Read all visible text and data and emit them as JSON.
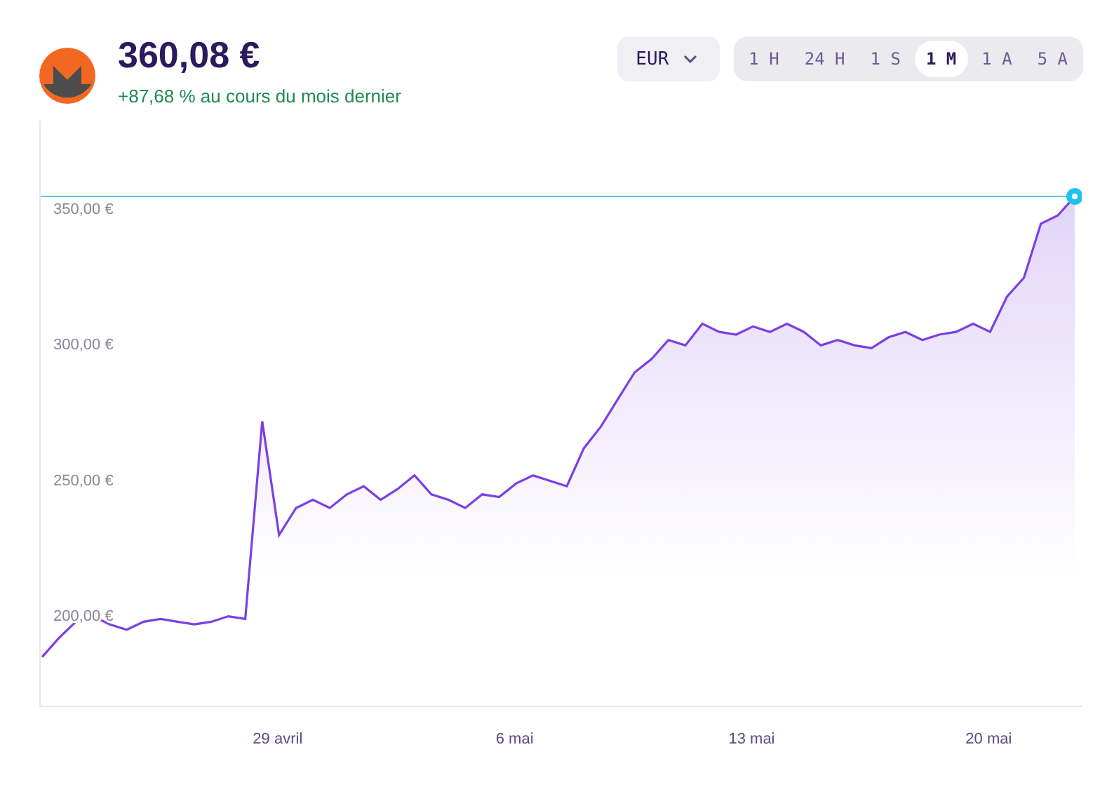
{
  "asset": {
    "price": "360,08 €",
    "change": "+87,68 % au cours du mois dernier"
  },
  "currency": {
    "value": "EUR"
  },
  "periods": [
    {
      "label": "1 H",
      "selected": false
    },
    {
      "label": "24 H",
      "selected": false
    },
    {
      "label": "1 S",
      "selected": false
    },
    {
      "label": "1 M",
      "selected": true
    },
    {
      "label": "1 A",
      "selected": false
    },
    {
      "label": "5 A",
      "selected": false
    }
  ],
  "chart": {
    "chart_data": {
      "type": "area",
      "ylim": [
        167,
        383
      ],
      "yticks": [
        {
          "value": 200,
          "label": "200,00 €"
        },
        {
          "value": 250,
          "label": "250,00 €"
        },
        {
          "value": 300,
          "label": "300,00 €"
        },
        {
          "value": 350,
          "label": "350,00 €"
        }
      ],
      "ref_lines": [
        {
          "axis": "y",
          "value": 355,
          "color": "#5bc8e8"
        }
      ],
      "series": [
        {
          "color": "#7b3fe4",
          "values": [
            185,
            192,
            198,
            200,
            197,
            195,
            198,
            199,
            198,
            197,
            198,
            200,
            199,
            272,
            230,
            240,
            243,
            240,
            245,
            248,
            243,
            247,
            252,
            245,
            243,
            240,
            245,
            244,
            249,
            252,
            250,
            248,
            262,
            270,
            280,
            290,
            295,
            302,
            300,
            308,
            305,
            304,
            307,
            305,
            308,
            305,
            300,
            302,
            300,
            299,
            303,
            305,
            302,
            304,
            305,
            308,
            305,
            318,
            325,
            345,
            348,
            355
          ]
        }
      ]
    },
    "x_labels": [
      "29 avril",
      "6 mai",
      "13 mai",
      "20 mai"
    ]
  }
}
